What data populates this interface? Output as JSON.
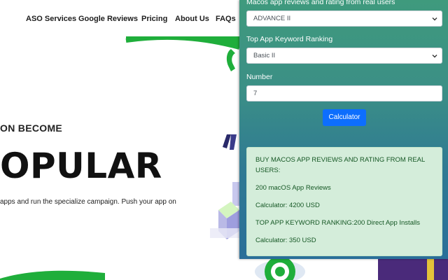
{
  "site": {
    "nav": [
      "ASO Services",
      "Google Reviews",
      "Pricing",
      "About Us",
      "FAQs"
    ],
    "hero_subtitle": "ON BECOME",
    "hero_title": "OPULAR",
    "hero_description": "apps and run the specialize campaign. Push your app on"
  },
  "popup": {
    "reviews_label": "Macos app reviews and rating from real users",
    "reviews_selected": "ADVANCE II",
    "keyword_label": "Top App Keyword Ranking",
    "keyword_selected": "Basic II",
    "number_label": "Number",
    "number_value": "7",
    "calculator_button": "Calculator",
    "result": {
      "heading": "BUY MACOS APP REVIEWS AND RATING FROM REAL USERS:",
      "reviews_line": "200 macOS App Reviews",
      "reviews_total": "Calculator: 4200 USD",
      "keyword_line": "TOP APP KEYWORD RANKING:200 Direct App Installs",
      "keyword_total": "Calculator: 350 USD"
    }
  },
  "colors": {
    "brand_green": "#1fae3b",
    "popup_gradient_top": "#3f9a7d",
    "popup_gradient_bottom": "#2a6f99",
    "button_blue": "#0d6efd",
    "result_bg": "#d4edda",
    "result_text": "#155724"
  }
}
